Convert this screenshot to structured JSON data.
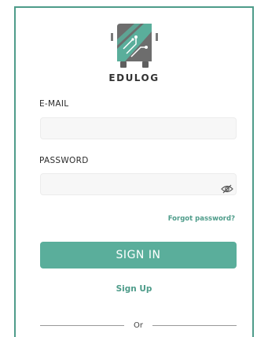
{
  "brand": {
    "name": "EDULOG",
    "logo_icon": "bus-circuit-logo-icon"
  },
  "form": {
    "email_label": "E-MAIL",
    "email_value": "",
    "email_placeholder": "",
    "password_label": "PASSWORD",
    "password_value": "",
    "password_placeholder": "",
    "toggle_icon": "eye-off-icon",
    "forgot_label": "Forgot password?",
    "signin_label": "SIGN IN",
    "signup_label": "Sign Up",
    "divider_label": "Or"
  },
  "colors": {
    "accent": "#5aae9b",
    "accent_text": "#4e9c8a",
    "border": "#4e9c8a",
    "field_bg": "#f7f7f7"
  }
}
